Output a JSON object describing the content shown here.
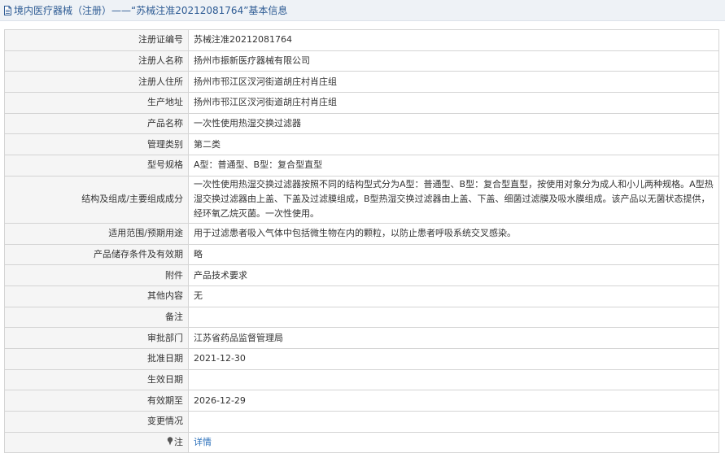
{
  "header": {
    "title": "境内医疗器械（注册）——“苏械注准20212081764”基本信息"
  },
  "rows": [
    {
      "label": "注册证编号",
      "value": "苏械注准20212081764"
    },
    {
      "label": "注册人名称",
      "value": "扬州市振新医疗器械有限公司"
    },
    {
      "label": "注册人住所",
      "value": "扬州市邗江区汊河街道胡庄村肖庄组"
    },
    {
      "label": "生产地址",
      "value": "扬州市邗江区汊河街道胡庄村肖庄组"
    },
    {
      "label": "产品名称",
      "value": "一次性使用热湿交换过滤器"
    },
    {
      "label": "管理类别",
      "value": "第二类"
    },
    {
      "label": "型号规格",
      "value": "A型：普通型、B型：复合型直型"
    },
    {
      "label": "结构及组成/主要组成成分",
      "value": "一次性使用热湿交换过滤器按照不同的结构型式分为A型：普通型、B型：复合型直型，按使用对象分为成人和小儿两种规格。A型热湿交换过滤器由上盖、下盖及过滤膜组成，B型热湿交换过滤器由上盖、下盖、细菌过滤膜及吸水膜组成。该产品以无菌状态提供，经环氧乙烷灭菌。一次性使用。"
    },
    {
      "label": "适用范围/预期用途",
      "value": "用于过滤患者吸入气体中包括微生物在内的颗粒，以防止患者呼吸系统交叉感染。"
    },
    {
      "label": "产品储存条件及有效期",
      "value": "略"
    },
    {
      "label": "附件",
      "value": "产品技术要求"
    },
    {
      "label": "其他内容",
      "value": "无"
    },
    {
      "label": "备注",
      "value": ""
    },
    {
      "label": "审批部门",
      "value": "江苏省药品监督管理局"
    },
    {
      "label": "批准日期",
      "value": "2021-12-30"
    },
    {
      "label": "生效日期",
      "value": ""
    },
    {
      "label": "有效期至",
      "value": "2026-12-29"
    },
    {
      "label": "变更情况",
      "value": ""
    },
    {
      "label": "注",
      "value": "详情"
    }
  ],
  "icons": {
    "header_icon": "document-icon",
    "note_icon": "pin-icon"
  },
  "colors": {
    "title": "#2c5a93",
    "link": "#2a6fba",
    "label_bg": "#f5f5f5",
    "border": "#d4d4d4"
  }
}
